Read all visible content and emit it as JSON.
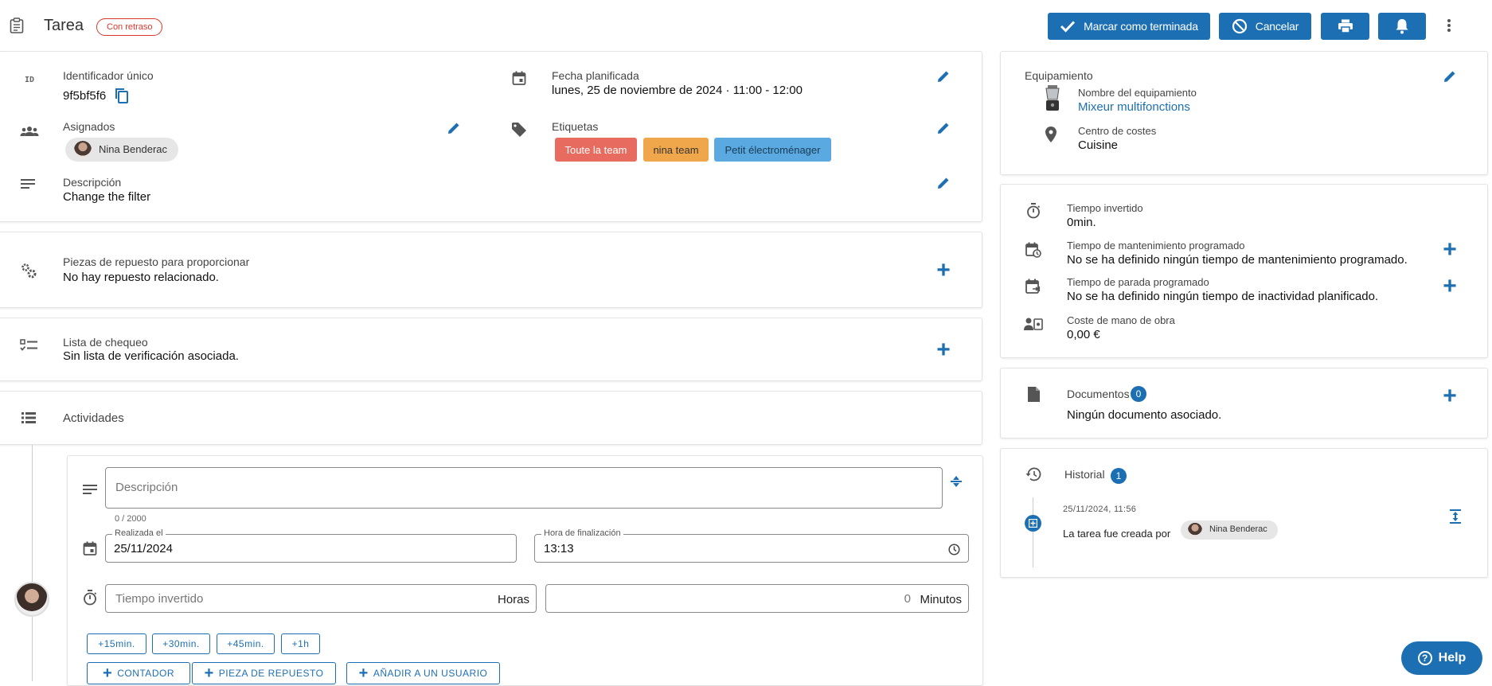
{
  "header": {
    "title": "Tarea",
    "status_badge": "Con retraso",
    "complete_label": "Marcar como terminada",
    "cancel_label": "Cancelar"
  },
  "details": {
    "id_label": "Identificador único",
    "id_value": "9f5bf5f6",
    "date_label": "Fecha planificada",
    "date_value": "lunes, 25 de noviembre de 2024 · 11:00 - 12:00",
    "assigned_label": "Asignados",
    "assigned_user": "Nina Benderac",
    "tags_label": "Etiquetas",
    "tags": [
      "Toute la team",
      "nina team",
      "Petit électroménager"
    ],
    "desc_label": "Descripción",
    "desc_value": "Change the filter"
  },
  "parts": {
    "label": "Piezas de repuesto para proporcionar",
    "value": "No hay repuesto relacionado."
  },
  "checklist": {
    "label": "Lista de chequeo",
    "value": "Sin lista de verificación asociada."
  },
  "activities": {
    "label": "Actividades"
  },
  "activity_form": {
    "desc_placeholder": "Descripción",
    "char_count": "0 / 2000",
    "done_label": "Realizada el",
    "done_value": "25/11/2024",
    "end_label": "Hora de finalización",
    "end_value": "13:13",
    "time_placeholder": "Tiempo invertido",
    "hours_unit": "Horas",
    "minutes_value": "0",
    "minutes_unit": "Minutos",
    "quick": [
      "+15min.",
      "+30min.",
      "+45min.",
      "+1h"
    ],
    "counter_label": "CONTADOR",
    "part_label": "PIEZA DE REPUESTO",
    "user_label": "AÑADIR A UN USUARIO"
  },
  "equipment": {
    "label": "Equipamiento",
    "name_label": "Nombre del equipamiento",
    "name_value": "Mixeur multifonctions",
    "cost_center_label": "Centro de costes",
    "cost_center_value": "Cuisine"
  },
  "times": {
    "spent_label": "Tiempo invertido",
    "spent_value": "0min.",
    "maint_label": "Tiempo de mantenimiento programado",
    "maint_value": "No se ha definido ningún tiempo de mantenimiento programado.",
    "down_label": "Tiempo de parada programado",
    "down_value": "No se ha definido ningún tiempo de inactividad planificado.",
    "labor_label": "Coste de mano de obra",
    "labor_value": "0,00 €"
  },
  "documents": {
    "label": "Documentos",
    "count": "0",
    "empty": "Ningún documento asociado."
  },
  "history": {
    "label": "Historial",
    "count": "1",
    "timestamp": "25/11/2024, 11:56",
    "event": "La tarea fue creada por",
    "user": "Nina Benderac"
  },
  "help": {
    "label": "Help"
  },
  "colors": {
    "primary": "#1d6fb3",
    "tag1": "#e86b5f",
    "tag2": "#f0a64a",
    "tag3": "#5aa9e0",
    "late": "#d9382e"
  }
}
